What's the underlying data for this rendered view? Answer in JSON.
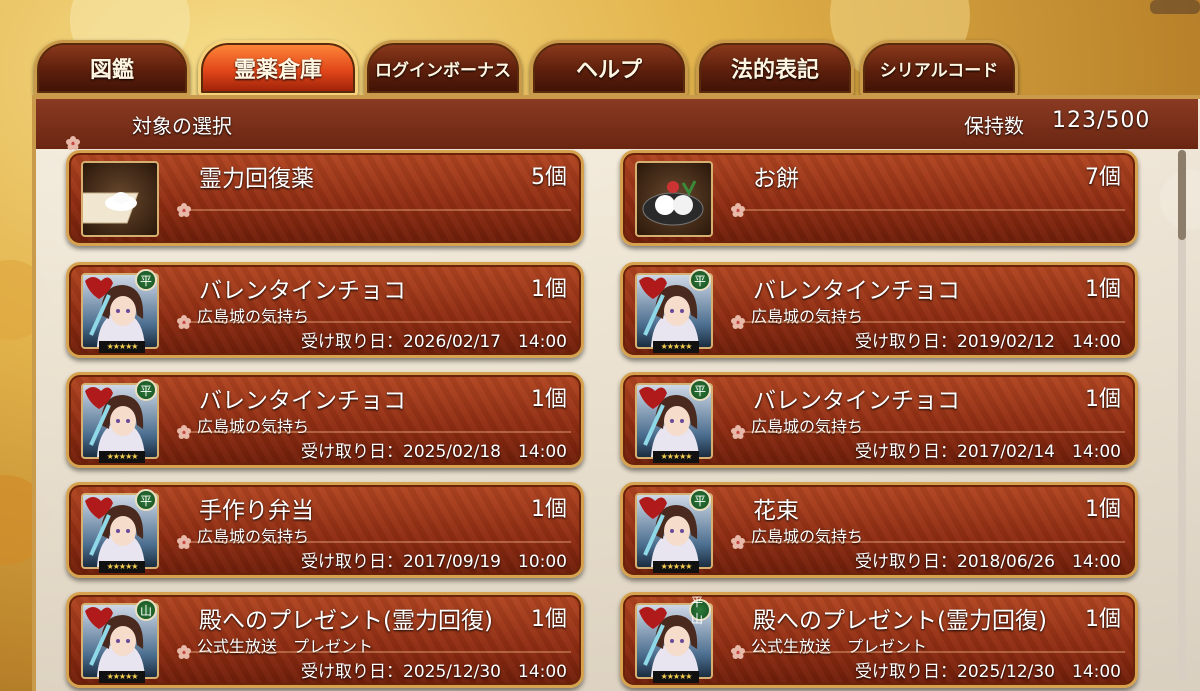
{
  "tabs": [
    {
      "label": "図鑑",
      "active": false
    },
    {
      "label": "霊薬倉庫",
      "active": true
    },
    {
      "label": "ログインボーナス",
      "active": false
    },
    {
      "label": "ヘルプ",
      "active": false
    },
    {
      "label": "法的表記",
      "active": false
    },
    {
      "label": "シリアルコード",
      "active": false
    }
  ],
  "header": {
    "title": "対象の選択",
    "count_label": "保持数",
    "count_value": "123/500"
  },
  "items": [
    {
      "name": "霊力回復薬",
      "qty": "5個",
      "desc": "",
      "date": "",
      "thumb": "powder-icon"
    },
    {
      "name": "お餅",
      "qty": "7個",
      "desc": "",
      "date": "",
      "thumb": "mochi-icon"
    },
    {
      "name": "バレンタインチョコ",
      "qty": "1個",
      "desc": "広島城の気持ち",
      "date": "受け取り日：2026/02/17　14:00",
      "thumb": "chocolate-character",
      "badge": "平"
    },
    {
      "name": "バレンタインチョコ",
      "qty": "1個",
      "desc": "広島城の気持ち",
      "date": "受け取り日：2019/02/12　14:00",
      "thumb": "chocolate-character",
      "badge": "平"
    },
    {
      "name": "バレンタインチョコ",
      "qty": "1個",
      "desc": "広島城の気持ち",
      "date": "受け取り日：2025/02/18　14:00",
      "thumb": "chocolate-character",
      "badge": "平"
    },
    {
      "name": "バレンタインチョコ",
      "qty": "1個",
      "desc": "広島城の気持ち",
      "date": "受け取り日：2017/02/14　14:00",
      "thumb": "chocolate-character",
      "badge": "平"
    },
    {
      "name": "手作り弁当",
      "qty": "1個",
      "desc": "広島城の気持ち",
      "date": "受け取り日：2017/09/19　10:00",
      "thumb": "lunchbox-character",
      "badge": "平"
    },
    {
      "name": "花束",
      "qty": "1個",
      "desc": "広島城の気持ち",
      "date": "受け取り日：2018/06/26　14:00",
      "thumb": "bouquet-character",
      "badge": "平"
    },
    {
      "name": "殿へのプレゼント(霊力回復)",
      "qty": "1個",
      "desc": "公式生放送　プレゼント",
      "date": "受け取り日：2025/12/30　14:00",
      "thumb": "gift-character",
      "badge": "山"
    },
    {
      "name": "殿へのプレゼント(霊力回復)",
      "qty": "1個",
      "desc": "公式生放送　プレゼント",
      "date": "受け取り日：2025/12/30　14:00",
      "thumb": "gift-character",
      "badge": "平山"
    }
  ],
  "stars_text": "★★★★★"
}
